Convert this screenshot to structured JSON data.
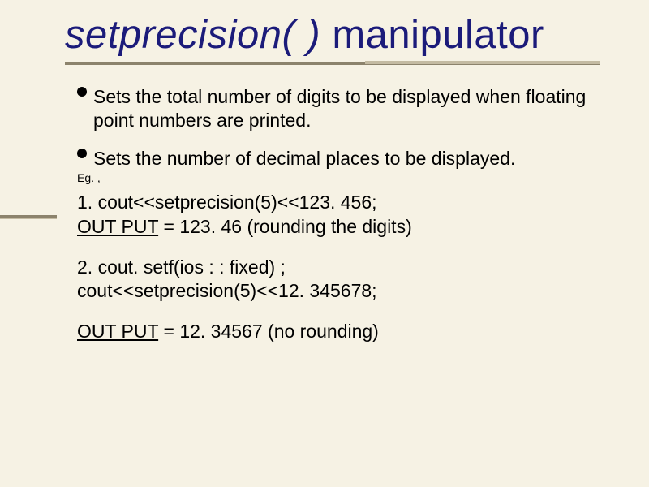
{
  "title": {
    "italic": "setprecision( )",
    "rest": " manipulator"
  },
  "bullets": [
    "Sets the total number of digits to be displayed when floating point numbers are printed.",
    "Sets the number of decimal places to be displayed."
  ],
  "eg_label": "Eg. ,",
  "examples": [
    {
      "lines": [
        "1. cout<<setprecision(5)<<123. 456;"
      ],
      "output_label": "OUT PUT",
      "output_value": " = 123. 46 (rounding the digits)"
    },
    {
      "lines": [
        "2. cout. setf(ios : : fixed) ;",
        "cout<<setprecision(5)<<12. 345678;"
      ],
      "output_label": "OUT PUT",
      "output_value": " = 12. 34567 (no rounding)"
    }
  ]
}
